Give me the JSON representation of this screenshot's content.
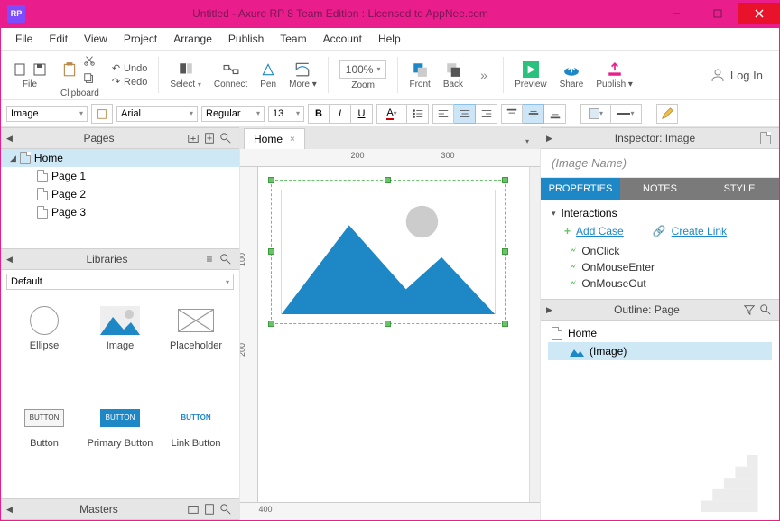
{
  "window": {
    "title": "Untitled - Axure RP 8 Team Edition : Licensed to AppNee.com",
    "icon": "RP"
  },
  "menus": [
    "File",
    "Edit",
    "View",
    "Project",
    "Arrange",
    "Publish",
    "Team",
    "Account",
    "Help"
  ],
  "toolbar": {
    "file": "File",
    "clipboard": "Clipboard",
    "undo": "Undo",
    "redo": "Redo",
    "select": "Select",
    "connect": "Connect",
    "pen": "Pen",
    "more": "More ▾",
    "zoom": "Zoom",
    "zoom_value": "100%",
    "front": "Front",
    "back": "Back",
    "preview": "Preview",
    "share": "Share",
    "publish": "Publish ▾",
    "login": "Log In"
  },
  "format": {
    "widget_type": "Image",
    "font": "Arial",
    "weight": "Regular",
    "size": "13"
  },
  "panels": {
    "pages": "Pages",
    "libraries": "Libraries",
    "masters": "Masters",
    "inspector": "Inspector: Image",
    "outline": "Outline: Page"
  },
  "pages": {
    "root": "Home",
    "children": [
      "Page 1",
      "Page 2",
      "Page 3"
    ]
  },
  "library": {
    "set": "Default",
    "widgets": {
      "ellipse": "Ellipse",
      "image": "Image",
      "placeholder": "Placeholder",
      "button": "Button",
      "primary_button": "Primary Button",
      "link_button": "Link Button",
      "button_sample": "BUTTON"
    }
  },
  "canvas": {
    "tab": "Home",
    "ruler_h": [
      "200",
      "300"
    ],
    "ruler_v": [
      "100",
      "200"
    ],
    "ruler_b": [
      "400"
    ]
  },
  "inspector": {
    "name_placeholder": "(Image Name)",
    "tabs": {
      "properties": "PROPERTIES",
      "notes": "NOTES",
      "style": "STYLE"
    },
    "interactions_label": "Interactions",
    "add_case": "Add Case",
    "create_link": "Create Link",
    "events": [
      "OnClick",
      "OnMouseEnter",
      "OnMouseOut"
    ]
  },
  "outline": {
    "root": "Home",
    "child": "(Image)"
  }
}
